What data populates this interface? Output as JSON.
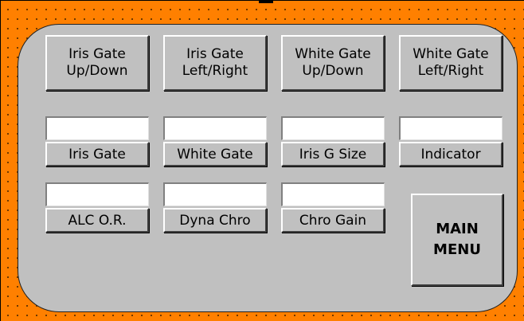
{
  "colors": {
    "frame": "#ff8000",
    "panel": "#c0c0c0",
    "field": "#ffffff"
  },
  "top_buttons": [
    {
      "label": "Iris Gate\nUp/Down"
    },
    {
      "label": "Iris Gate\nLeft/Right"
    },
    {
      "label": "White Gate\nUp/Down"
    },
    {
      "label": "White Gate\nLeft/Right"
    }
  ],
  "fields_row1": [
    {
      "value": "",
      "label": "Iris Gate"
    },
    {
      "value": "",
      "label": "White Gate"
    },
    {
      "value": "",
      "label": "Iris G Size"
    },
    {
      "value": "",
      "label": "Indicator"
    }
  ],
  "fields_row2": [
    {
      "value": "",
      "label": "ALC O.R."
    },
    {
      "value": "",
      "label": "Dyna Chro"
    },
    {
      "value": "",
      "label": "Chro Gain"
    }
  ],
  "main_menu": {
    "label": "MAIN\nMENU"
  }
}
